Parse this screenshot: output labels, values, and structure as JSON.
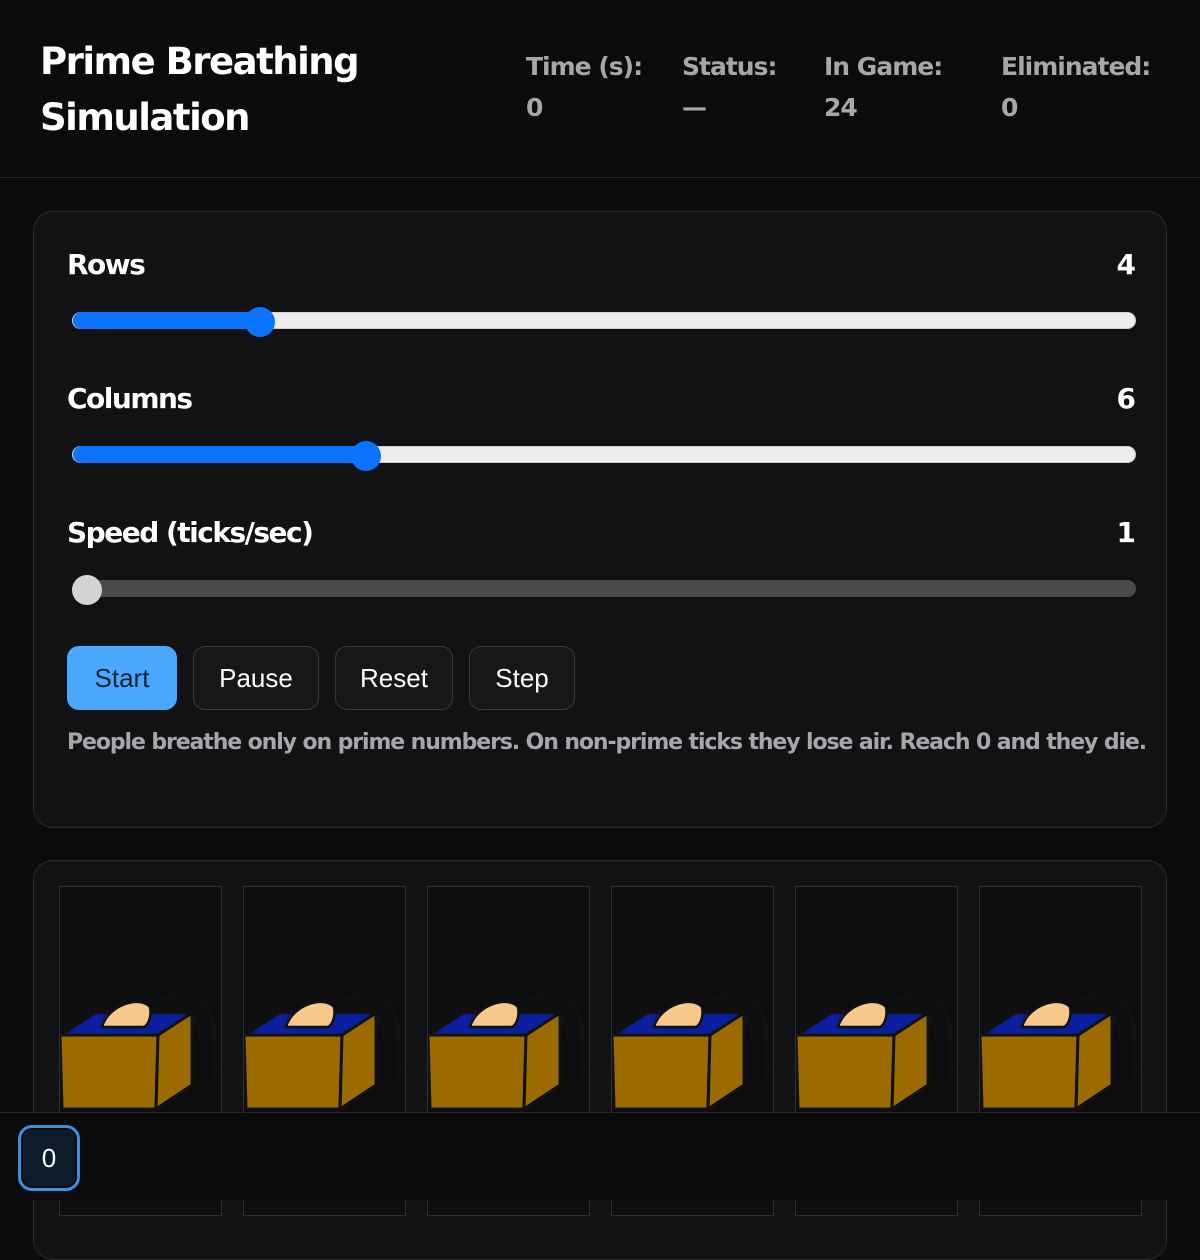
{
  "header": {
    "title": "Prime Breathing Simulation",
    "stats": [
      {
        "label": "Time (s):",
        "value": "0"
      },
      {
        "label": "Status:",
        "value": "—"
      },
      {
        "label": "In Game:",
        "value": "24"
      },
      {
        "label": "Eliminated:",
        "value": "0"
      }
    ]
  },
  "controls": {
    "rows": {
      "label": "Rows",
      "value": "4",
      "fraction": 0.167
    },
    "columns": {
      "label": "Columns",
      "value": "6",
      "fraction": 0.269
    },
    "speed": {
      "label": "Speed (ticks/sec)",
      "value": "1",
      "fraction": 0.0
    },
    "buttons": {
      "start": "Start",
      "pause": "Pause",
      "reset": "Reset",
      "step": "Step"
    },
    "hint": "People breathe only on prime numbers. On non-prime ticks they lose air. Reach 0 and they die."
  },
  "grid": {
    "visible_cells": 6,
    "colors": {
      "box": "#9b6b00",
      "water": "#0b1ea0",
      "skin": "#f7c88a"
    }
  },
  "bottombar": {
    "counter": "0"
  },
  "colors": {
    "accent": "#0b73ff",
    "primary_button": "#4aa8ff",
    "background": "#0b0b0c",
    "card": "#121215"
  }
}
